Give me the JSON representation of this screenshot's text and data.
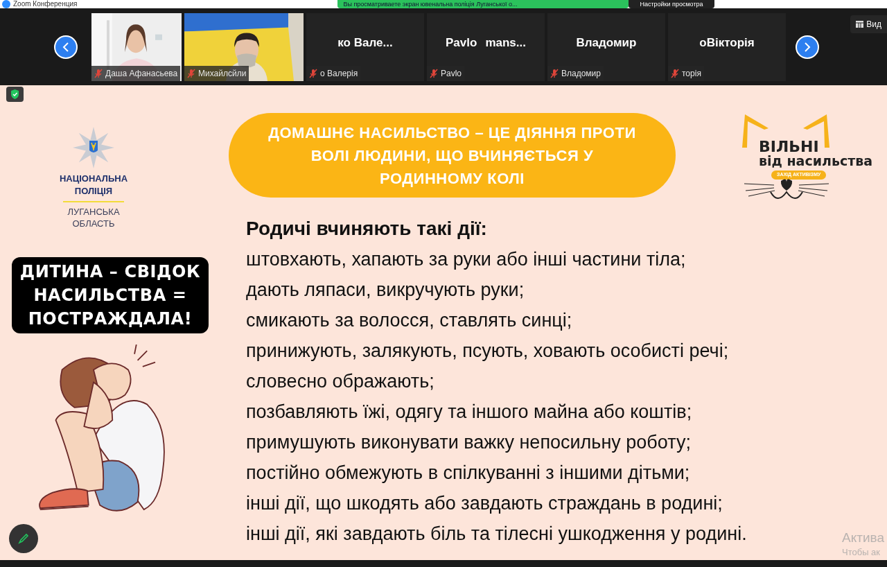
{
  "window": {
    "title": "Zoom Конференция"
  },
  "share_banner": {
    "text": "Вы просматриваете экран ювенальна поліція Луганської о...",
    "view_options": "Настройки просмотра"
  },
  "participants": [
    {
      "kind": "video",
      "name": "Даша Афанасьева",
      "muted": true
    },
    {
      "kind": "video",
      "name": "Михайлсйли",
      "muted": true
    },
    {
      "kind": "name",
      "display": [
        "ко Вале..."
      ],
      "name": "о Валерія",
      "muted": true
    },
    {
      "kind": "name",
      "display": [
        "Pavlo",
        "mans..."
      ],
      "name": "Pavlo",
      "muted": true
    },
    {
      "kind": "name",
      "display": [
        "Владомир"
      ],
      "name": "Владомир",
      "muted": true
    },
    {
      "kind": "name",
      "display": [
        "оВікторія"
      ],
      "name": "торія",
      "muted": true
    }
  ],
  "view_button": "Вид",
  "slide": {
    "police_logo": [
      "НАЦІОНАЛЬНА",
      "ПОЛІЦІЯ",
      "ЛУГАНСЬКА",
      "ОБЛАСТЬ"
    ],
    "banner": [
      "ДОМАШНЄ НАСИЛЬСТВО – ЦЕ ДІЯННЯ ПРОТИ",
      "ВОЛІ ЛЮДИНИ, ЩО ВЧИНЯЄТЬСЯ У",
      "РОДИННОМУ КОЛІ"
    ],
    "campaign_logo": {
      "title": "ВІЛЬНІ",
      "subtitle": "від насильства",
      "tag": "ЗАХІД АКТИВІЗМУ"
    },
    "callout": [
      "ДИТИНА – СВІДОК",
      "НАСИЛЬСТВА =",
      "ПОСТРАЖДАЛА!"
    ],
    "heading": "Родичі вчиняють такі дії:",
    "items": [
      "штовхають, хапають за руки або інші частини тіла;",
      "дають ляпаси, викручують руки;",
      "смикають за волосся, ставлять синці;",
      "принижують, залякують, псують, ховають особисті речі;",
      "словесно ображають;",
      "позбавляють їжі, одягу та іншого майна або коштів;",
      "примушують виконувати важку непосильну роботу;",
      "постійно обмежують в спілкуванні з іншими дітьми;",
      "інші дії, що шкодять або завдають страждань в родині;",
      "інші дії, які завдають біль та тілесні ушкодження у родині."
    ]
  },
  "activation_notice": [
    "Актива",
    "Чтобы ак"
  ]
}
